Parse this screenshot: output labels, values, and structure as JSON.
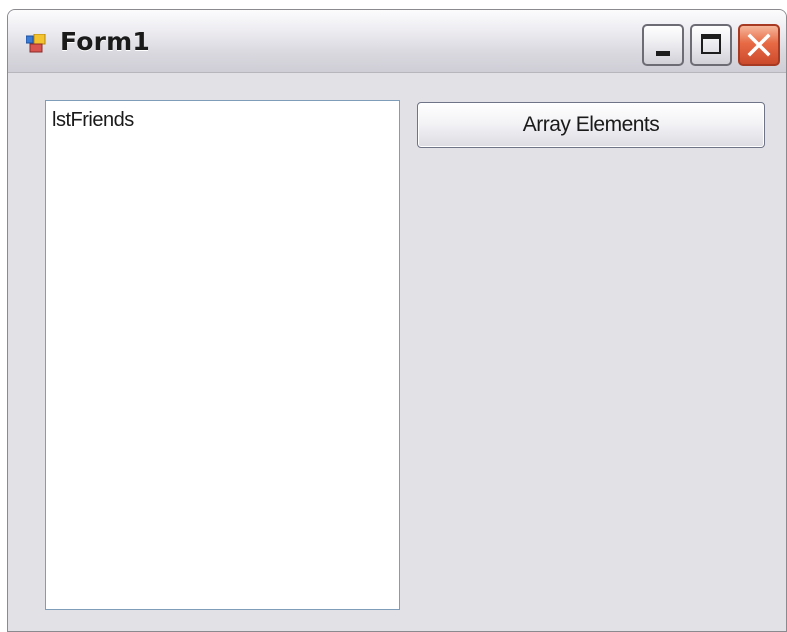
{
  "window": {
    "title": "Form1",
    "icon": "winforms-app-icon",
    "caption_buttons": {
      "minimize_icon": "minimize-icon",
      "maximize_icon": "maximize-icon",
      "close_icon": "close-icon"
    }
  },
  "listbox": {
    "name_label": "lstFriends"
  },
  "button": {
    "label": "Array Elements"
  },
  "colors": {
    "client_background": "#e2e1e6",
    "close_button": "#e76a45",
    "listbox_border": "#7f9db9"
  }
}
